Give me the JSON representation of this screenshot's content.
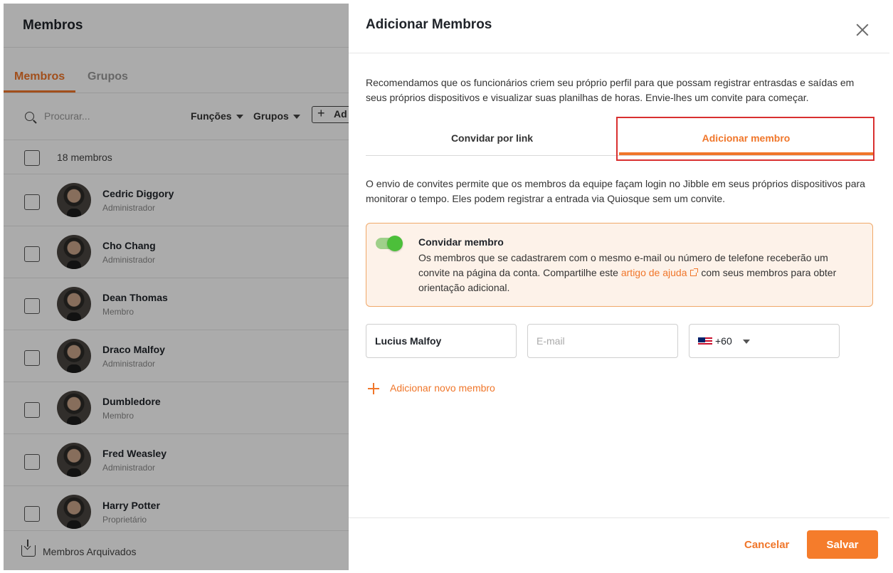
{
  "background": {
    "title": "Membros",
    "tabs": [
      "Membros",
      "Grupos"
    ],
    "search_placeholder": "Procurar...",
    "filters": [
      "Funções",
      "Grupos"
    ],
    "add_button": "Ad",
    "member_count": "18 membros",
    "members": [
      {
        "name": "Cedric Diggory",
        "role": "Administrador"
      },
      {
        "name": "Cho Chang",
        "role": "Administrador"
      },
      {
        "name": "Dean Thomas",
        "role": "Membro"
      },
      {
        "name": "Draco Malfoy",
        "role": "Administrador"
      },
      {
        "name": "Dumbledore",
        "role": "Membro"
      },
      {
        "name": "Fred Weasley",
        "role": "Administrador"
      },
      {
        "name": "Harry Potter",
        "role": "Proprietário"
      }
    ],
    "archived_label": "Membros Arquivados"
  },
  "modal": {
    "title": "Adicionar Membros",
    "intro": "Recomendamos que os funcionários criem seu próprio perfil para que possam registrar entrasdas e saídas em seus próprios dispositivos e visualizar suas planilhas de horas. Envie-lhes um convite para começar.",
    "tabs": {
      "invite_link": "Convidar por link",
      "add_member": "Adicionar membro"
    },
    "description": "O envio de convites permite que os membros da equipe façam login no Jibble em seus próprios dispositivos para monitorar o tempo. Eles podem registrar a entrada via Quiosque sem um convite.",
    "callout": {
      "title": "Convidar membro",
      "text_before": "Os membros que se cadastrarem com o mesmo e-mail ou número de telefone receberão um convite na página da conta. Compartilhe este ",
      "link_text": "artigo de ajuda",
      "text_after": " com seus membros para obter orientação adicional.",
      "toggle_on": true
    },
    "form": {
      "name_value": "Lucius Malfoy",
      "email_placeholder": "E-mail",
      "phone_code": "+60",
      "flag": "malaysia-flag"
    },
    "add_new_member": "Adicionar novo membro",
    "buttons": {
      "cancel": "Cancelar",
      "save": "Salvar"
    }
  },
  "colors": {
    "accent": "#f0762a",
    "toggle_green": "#4cbf3a",
    "callout_bg": "#fdf2e9",
    "highlight_red": "#d93030"
  }
}
